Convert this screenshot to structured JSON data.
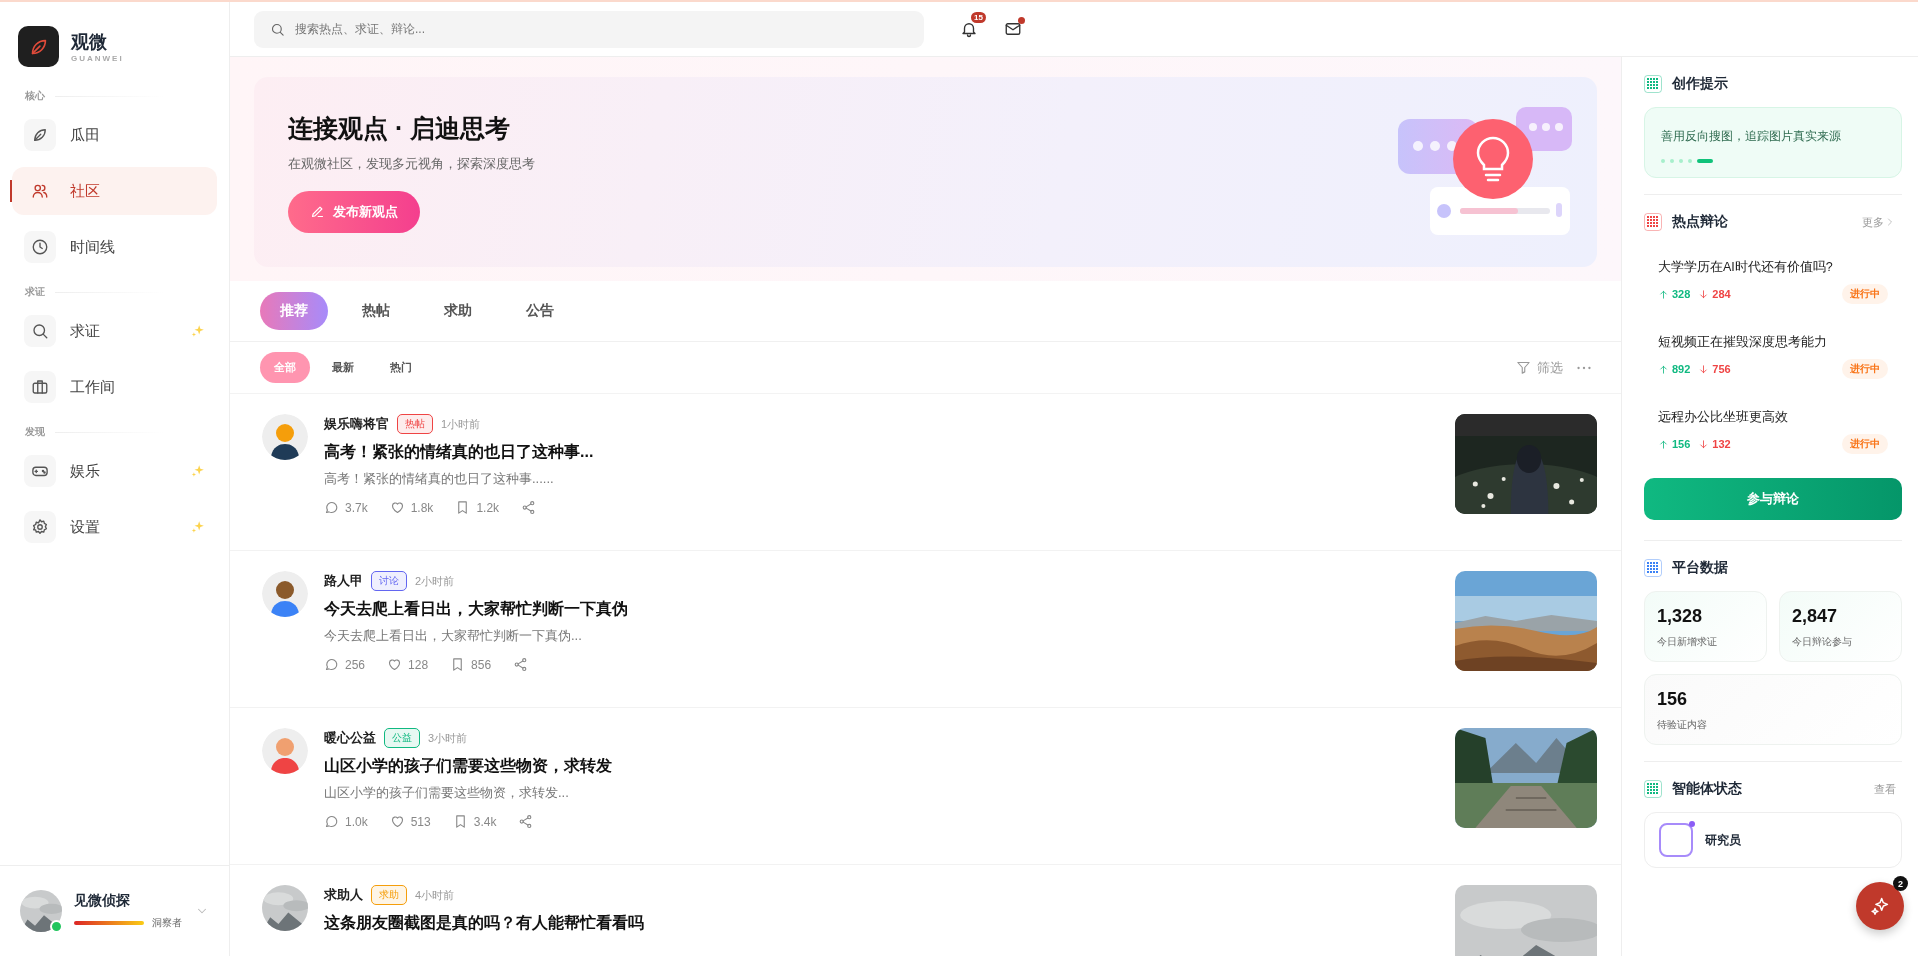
{
  "brand": {
    "name": "观微",
    "subtitle": "GUANWEI"
  },
  "sidebar": {
    "sections": [
      {
        "label": "核心",
        "items": [
          {
            "label": "瓜田",
            "selected": false,
            "sparkle": false
          },
          {
            "label": "社区",
            "selected": true,
            "sparkle": false
          },
          {
            "label": "时间线",
            "selected": false,
            "sparkle": false
          }
        ]
      },
      {
        "label": "求证",
        "items": [
          {
            "label": "求证",
            "selected": false,
            "sparkle": true
          },
          {
            "label": "工作间",
            "selected": false,
            "sparkle": false
          }
        ]
      },
      {
        "label": "发现",
        "items": [
          {
            "label": "娱乐",
            "selected": false,
            "sparkle": true
          },
          {
            "label": "设置",
            "selected": false,
            "sparkle": true
          }
        ]
      }
    ]
  },
  "user": {
    "name": "见微侦探",
    "rank": "洞察者",
    "online": true
  },
  "header": {
    "search": {
      "placeholder": "搜索热点、求证、辩论..."
    },
    "notifications": "15",
    "mail_unread": true
  },
  "banner": {
    "title": "连接观点 · 启迪思考",
    "subtitle": "在观微社区，发现多元视角，探索深度思考",
    "button": "发布新观点"
  },
  "tabs": [
    {
      "label": "推荐",
      "selected": true
    },
    {
      "label": "热帖",
      "selected": false
    },
    {
      "label": "求助",
      "selected": false
    },
    {
      "label": "公告",
      "selected": false
    }
  ],
  "filters": [
    {
      "label": "全部",
      "selected": true
    },
    {
      "label": "最新",
      "selected": false
    },
    {
      "label": "热门",
      "selected": false
    }
  ],
  "filter_button": "筛选",
  "posts": [
    {
      "author": "娱乐嗨将官",
      "tag": {
        "label": "热帖",
        "color": "#ef4444"
      },
      "time": "1小时前",
      "title": "高考！紧张的情绪真的也日了这种事...",
      "excerpt": "高考！紧张的情绪真的也日了这种事......",
      "comments": "3.7k",
      "likes": "1.8k",
      "saves": "1.2k"
    },
    {
      "author": "路人甲",
      "tag": {
        "label": "讨论",
        "color": "#6366f1"
      },
      "time": "2小时前",
      "title": "今天去爬上看日出，大家帮忙判断一下真伪",
      "excerpt": "今天去爬上看日出，大家帮忙判断一下真伪...",
      "comments": "256",
      "likes": "128",
      "saves": "856"
    },
    {
      "author": "暖心公益",
      "tag": {
        "label": "公益",
        "color": "#10b981"
      },
      "time": "3小时前",
      "title": "山区小学的孩子们需要这些物资，求转发",
      "excerpt": "山区小学的孩子们需要这些物资，求转发...",
      "comments": "1.0k",
      "likes": "513",
      "saves": "3.4k"
    },
    {
      "author": "求助人",
      "tag": {
        "label": "求助",
        "color": "#f59e0b"
      },
      "time": "4小时前",
      "title": "这条朋友圈截图是真的吗？有人能帮忙看看吗"
    }
  ],
  "tip": {
    "title": "创作提示",
    "text": "善用反向搜图，追踪图片真实来源",
    "dots": [
      {
        "selected": false
      },
      {
        "selected": false
      },
      {
        "selected": false
      },
      {
        "selected": false
      },
      {
        "selected": true
      }
    ]
  },
  "debates": {
    "title": "热点辩论",
    "more": "更多",
    "items": [
      {
        "title": "大学学历在AI时代还有价值吗?",
        "up": "328",
        "down": "284",
        "status": "进行中"
      },
      {
        "title": "短视频正在摧毁深度思考能力",
        "up": "892",
        "down": "756",
        "status": "进行中"
      },
      {
        "title": "远程办公比坐班更高效",
        "up": "156",
        "down": "132",
        "status": "进行中"
      }
    ],
    "button": "参与辩论"
  },
  "stats": {
    "title": "平台数据",
    "items": [
      {
        "value": "1,328",
        "label": "今日新增求证"
      },
      {
        "value": "2,847",
        "label": "今日辩论参与"
      },
      {
        "value": "156",
        "label": "待验证内容"
      }
    ]
  },
  "agents": {
    "title": "智能体状态",
    "more": "查看",
    "items": [
      {
        "name": "研究员",
        "online": true
      }
    ]
  },
  "fab": {
    "badge": "2"
  }
}
